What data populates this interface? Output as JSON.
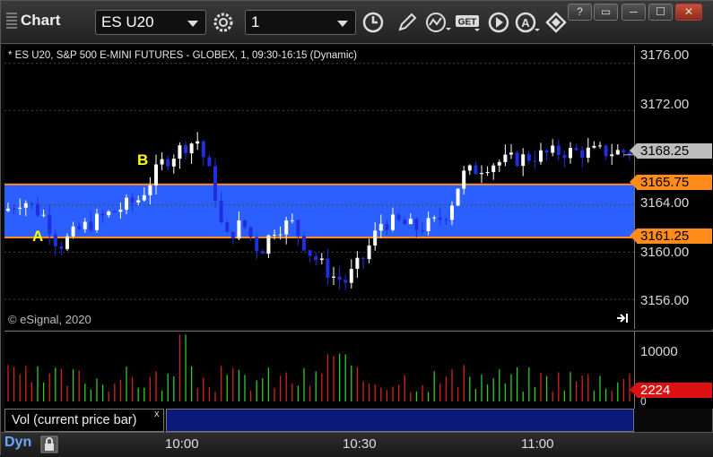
{
  "toolbar": {
    "title": "Chart",
    "symbol": "ES U20",
    "interval": "1",
    "window_buttons": [
      "?",
      "▭",
      "─",
      "☐",
      "✕"
    ]
  },
  "chart": {
    "header": "* ES U20, S&P 500 E-MINI FUTURES - GLOBEX, 1, 09:30-16:15 (Dynamic)",
    "copyright": "© eSignal, 2020",
    "label_a": "A",
    "label_b": "B",
    "price_ticks": [
      "3176.00",
      "3172.00",
      "3164.00",
      "3160.00",
      "3156.00"
    ],
    "tag_last": "3168.25",
    "tag_upper": "3165.75",
    "tag_lower": "3161.25",
    "colors": {
      "up": "#ffffff",
      "down": "#1f2fe0",
      "band": "#2b5fff",
      "band_edge": "#ff8c1a"
    }
  },
  "volume": {
    "study_label": "Vol (current price bar)",
    "close_x": "x",
    "tick_top": "10000",
    "tick_zero": "0",
    "tag_current": "2224"
  },
  "time_axis": {
    "mode": "Dyn",
    "times": [
      "10:00",
      "10:30",
      "11:00"
    ]
  },
  "chart_data": {
    "type": "candlestick",
    "title": "* ES U20, S&P 500 E-MINI FUTURES - GLOBEX, 1, 09:30-16:15 (Dynamic)",
    "ylim": [
      3153.5,
      3177.5
    ],
    "highlight_band": [
      3161.25,
      3165.75
    ],
    "last_price": 3168.25,
    "x_ticks": [
      "10:00",
      "10:30",
      "11:00"
    ],
    "volume_ticks": [
      0,
      10000
    ],
    "volume_current": 2224
  }
}
